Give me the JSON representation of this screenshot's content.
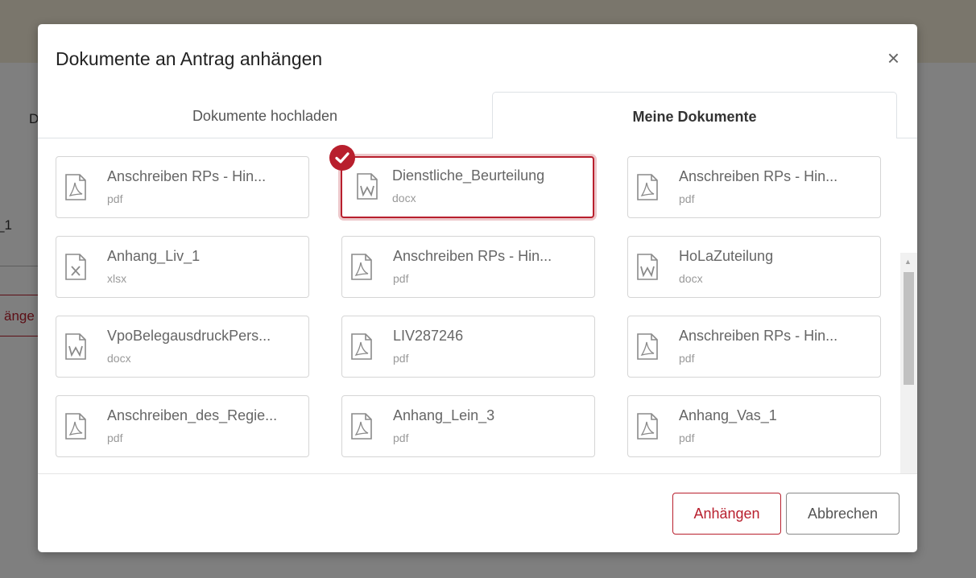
{
  "background": {
    "label_do": "Do",
    "label_1": "_1",
    "button_partial": "änge"
  },
  "modal": {
    "title": "Dokumente an Antrag anhängen",
    "close_label": "×",
    "tabs": [
      {
        "label": "Dokumente hochladen",
        "active": false
      },
      {
        "label": "Meine Dokumente",
        "active": true
      }
    ],
    "documents": [
      {
        "name": "Anschreiben RPs - Hin...",
        "ext": "pdf",
        "icon": "pdf-file-icon",
        "selected": false
      },
      {
        "name": "Dienstliche_Beurteilung",
        "ext": "docx",
        "icon": "word-file-icon",
        "selected": true
      },
      {
        "name": "Anschreiben RPs - Hin...",
        "ext": "pdf",
        "icon": "pdf-file-icon",
        "selected": false
      },
      {
        "name": "Anhang_Liv_1",
        "ext": "xlsx",
        "icon": "excel-file-icon",
        "selected": false
      },
      {
        "name": "Anschreiben RPs - Hin...",
        "ext": "pdf",
        "icon": "pdf-file-icon",
        "selected": false
      },
      {
        "name": "HoLaZuteilung",
        "ext": "docx",
        "icon": "word-file-icon",
        "selected": false
      },
      {
        "name": "VpoBelegausdruckPers...",
        "ext": "docx",
        "icon": "word-file-icon",
        "selected": false
      },
      {
        "name": "LIV287246",
        "ext": "pdf",
        "icon": "pdf-file-icon",
        "selected": false
      },
      {
        "name": "Anschreiben RPs - Hin...",
        "ext": "pdf",
        "icon": "pdf-file-icon",
        "selected": false
      },
      {
        "name": "Anschreiben_des_Regie...",
        "ext": "pdf",
        "icon": "pdf-file-icon",
        "selected": false
      },
      {
        "name": "Anhang_Lein_3",
        "ext": "pdf",
        "icon": "pdf-file-icon",
        "selected": false
      },
      {
        "name": "Anhang_Vas_1",
        "ext": "pdf",
        "icon": "pdf-file-icon",
        "selected": false
      }
    ],
    "footer": {
      "attach_label": "Anhängen",
      "cancel_label": "Abbrechen"
    }
  },
  "colors": {
    "accent": "#b81f2d",
    "icon_gray": "#8a8a8a",
    "header_bg": "#f5ecd9"
  }
}
